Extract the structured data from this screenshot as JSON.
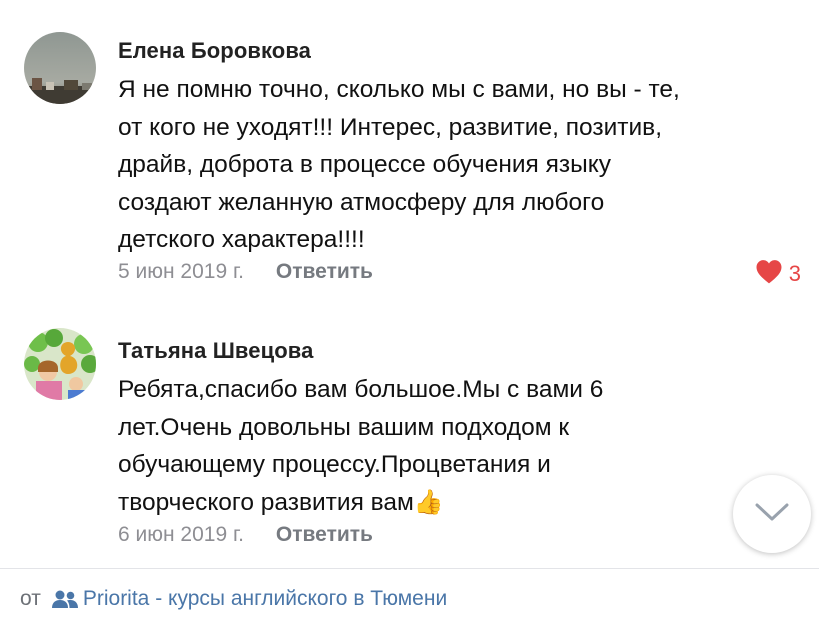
{
  "comments": [
    {
      "author": "Елена Боровкова",
      "lines": [
        "Я не помню точно, сколько мы с вами, но вы - те,",
        "от кого не уходят!!! Интерес, развитие, позитив,",
        "драйв, доброта в процессе обучения языку",
        "создают желанную атмосферу для любого",
        "детского характера!!!!"
      ],
      "date": "5 июн 2019 г.",
      "reply_label": "Ответить",
      "likes": "3"
    },
    {
      "author": "Татьяна Швецова",
      "lines": [
        "Ребята,спасибо вам большое.Мы с вами 6",
        "лет.Очень довольны вашим подходом к",
        "обучающему процессу.Процветания и",
        "творческого развития вам"
      ],
      "emoji": "👍",
      "date": "6 июн 2019 г.",
      "reply_label": "Ответить"
    }
  ],
  "footer": {
    "prefix": "от",
    "source": "Priorita - курсы английского в Тюмени"
  },
  "colors": {
    "like": "#e64646",
    "link": "#4a76a8",
    "muted": "#8e8e93"
  },
  "icons": [
    "heart-icon",
    "group-icon",
    "chevron-down-icon"
  ]
}
